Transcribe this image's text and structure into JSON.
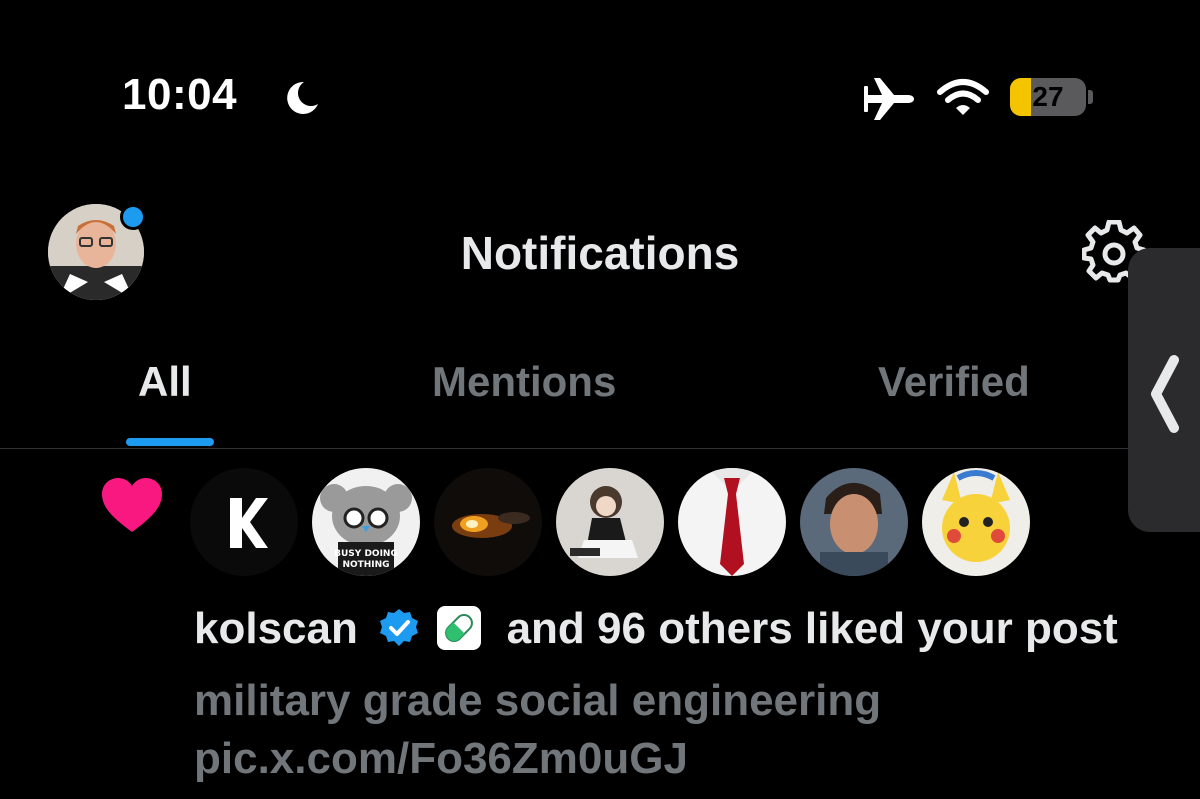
{
  "status_bar": {
    "time": "10:04",
    "battery_level": "27",
    "icons": [
      "moon-icon",
      "airplane-mode-icon",
      "wifi-icon",
      "battery-icon"
    ],
    "battery_fill_fraction": 0.27,
    "battery_fill_color": "#f4c400"
  },
  "header": {
    "title": "Notifications",
    "icons": [
      "profile-avatar",
      "settings-gear-icon"
    ]
  },
  "tabs": [
    {
      "label": "All",
      "active": true
    },
    {
      "label": "Mentions",
      "active": false
    },
    {
      "label": "Verified",
      "active": false
    }
  ],
  "notification": {
    "type_icon": "heart-icon",
    "actor_avatars": [
      "kolscan",
      "busy-doing-nothing",
      "fire",
      "figurine",
      "red-tie",
      "face",
      "pikachu"
    ],
    "avatar_text": "BUSY DOING NOTHING",
    "actor_name": "kolscan",
    "badge_icon": "verified-badge-icon",
    "emoji": "pill-emoji",
    "action_text": "and 96 others liked your post",
    "post_text": "military grade social engineering",
    "post_link": "pic.x.com/Fo36Zm0uGJ"
  },
  "colors": {
    "accent": "#1d9bf0",
    "heart": "#f91880",
    "muted_text": "#71767b",
    "background": "#000000"
  }
}
